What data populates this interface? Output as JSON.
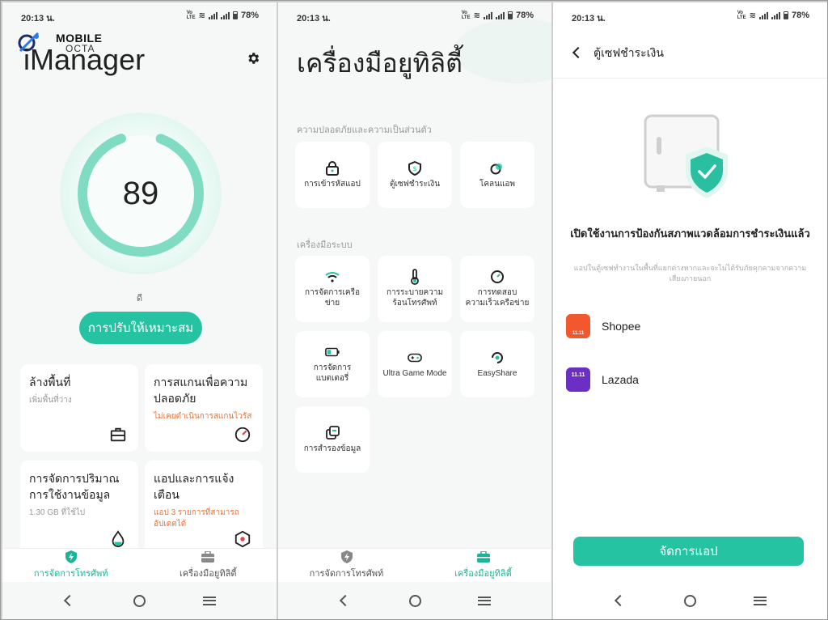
{
  "status": {
    "time": "20:13 น.",
    "battery": "78%"
  },
  "panel1": {
    "brand_name": "MOBILE",
    "brand_sub": "OCTA",
    "title": "iManager",
    "score": "89",
    "score_label": "ดี",
    "score_ring_fraction": 0.89,
    "optimize_label": "การปรับให้เหมาะสม",
    "cards": [
      {
        "title": "ล้างพื้นที่",
        "subtitle": "เพิ่มพื้นที่ว่าง",
        "icon": "briefcase-icon",
        "warn": false
      },
      {
        "title": "การสแกนเพื่อความปลอดภัย",
        "subtitle": "ไม่เคยดำเนินการสแกนไวรัส",
        "icon": "gauge-icon",
        "warn": true
      },
      {
        "title": "การจัดการปริมาณการใช้งานข้อมูล",
        "subtitle": "1.30 GB ที่ใช้ไป",
        "icon": "droplet-icon",
        "warn": false
      },
      {
        "title": "แอปและการแจ้งเตือน",
        "subtitle": "แอป 3 รายการที่สามารถอัปเดตได้",
        "icon": "hexagon-icon",
        "warn": true
      }
    ],
    "tabs": [
      {
        "label": "การจัดการโทรศัพท์",
        "active": true
      },
      {
        "label": "เครื่องมือยูทิลิตี้",
        "active": false
      }
    ]
  },
  "panel2": {
    "title": "เครื่องมือยูทิลิตี้",
    "section1": "ความปลอดภัยและความเป็นส่วนตัว",
    "section2": "เครื่องมือระบบ",
    "privacy_tools": [
      {
        "label": "การเข้ารหัสแอป",
        "icon": "lock-icon"
      },
      {
        "label": "ตู้เซฟชำระเงิน",
        "icon": "shield-dollar-icon"
      },
      {
        "label": "โคลนแอพ",
        "icon": "clone-icon"
      }
    ],
    "system_tools": [
      {
        "label": "การจัดการเครือข่าย",
        "icon": "wifi-icon"
      },
      {
        "label": "การระบายความร้อนโทรศัพท์",
        "icon": "thermometer-icon"
      },
      {
        "label": "การทดสอบความเร็วเครือข่าย",
        "icon": "speed-icon"
      },
      {
        "label": "การจัดการแบตเตอรี่",
        "icon": "battery-icon"
      },
      {
        "label": "Ultra Game Mode",
        "icon": "gamepad-icon"
      },
      {
        "label": "EasyShare",
        "icon": "easyshare-icon"
      },
      {
        "label": "การสำรองข้อมูล",
        "icon": "backup-icon"
      }
    ],
    "tabs": [
      {
        "label": "การจัดการโทรศัพท์",
        "active": false
      },
      {
        "label": "เครื่องมือยูทิลิตี้",
        "active": true
      }
    ]
  },
  "panel3": {
    "title": "ตู้เซฟชำระเงิน",
    "heading": "เปิดใช้งานการป้องกันสภาพแวดล้อมการชำระเงินแล้ว",
    "description": "แอปในตู้เซฟทำงานในพื้นที่แยกต่างหากและจะไม่ได้รับภัยคุกคามจากความเสี่ยงภายนอก",
    "apps": [
      {
        "name": "Shopee",
        "icon": "shopee-icon",
        "badge": "11.11",
        "color": "#f2572d"
      },
      {
        "name": "Lazada",
        "icon": "lazada-icon",
        "badge": "11.11",
        "color": "#6b2fc4"
      }
    ],
    "manage_label": "จัดการแอป"
  },
  "colors": {
    "accent": "#26c3a3",
    "warn": "#e8753a"
  }
}
